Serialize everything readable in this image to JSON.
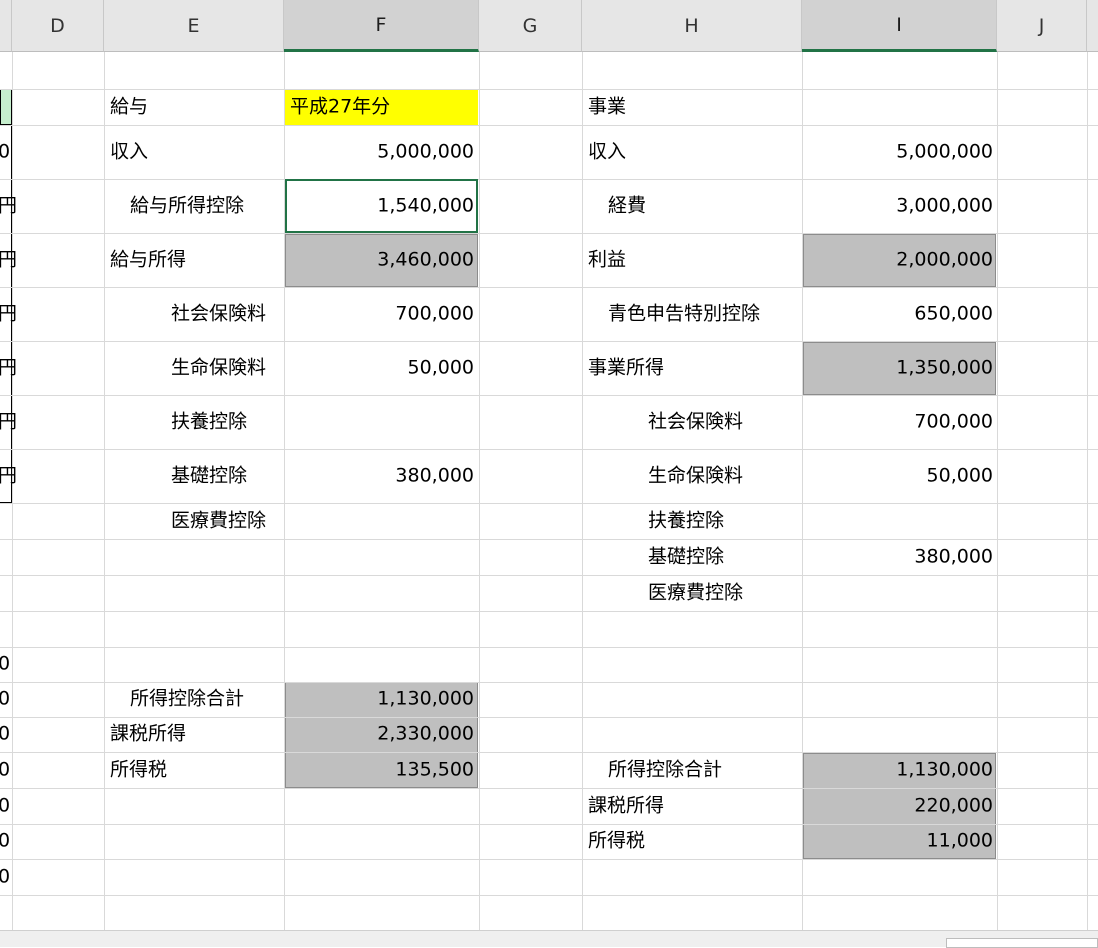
{
  "columns": [
    "D",
    "E",
    "F",
    "G",
    "H",
    "I",
    "J"
  ],
  "left_fragments": {
    "row3": "0",
    "row4": "円",
    "row5": "円",
    "row6": "円",
    "row7": "円",
    "row8": "円",
    "row9": "円",
    "row13": "0",
    "row14": "0",
    "row15": "0",
    "row16": "0",
    "row17": "0",
    "row18": "0",
    "row19": "0"
  },
  "salary": {
    "title": "給与",
    "year": "平成27年分",
    "income_label": "収入",
    "income": "5,000,000",
    "deduction_label": "給与所得控除",
    "deduction": "1,540,000",
    "salary_income_label": "給与所得",
    "salary_income": "3,460,000",
    "social_label": "社会保険料",
    "social": "700,000",
    "life_label": "生命保険料",
    "life": "50,000",
    "dependent_label": "扶養控除",
    "basic_label": "基礎控除",
    "basic": "380,000",
    "medical_label": "医療費控除",
    "total_deduction_label": "所得控除合計",
    "total_deduction": "1,130,000",
    "taxable_label": "課税所得",
    "taxable": "2,330,000",
    "tax_label": "所得税",
    "tax": "135,500"
  },
  "business": {
    "title": "事業",
    "income_label": "収入",
    "income": "5,000,000",
    "expense_label": "経費",
    "expense": "3,000,000",
    "profit_label": "利益",
    "profit": "2,000,000",
    "blue_label": "青色申告特別控除",
    "blue": "650,000",
    "business_income_label": "事業所得",
    "business_income": "1,350,000",
    "social_label": "社会保険料",
    "social": "700,000",
    "life_label": "生命保険料",
    "life": "50,000",
    "dependent_label": "扶養控除",
    "basic_label": "基礎控除",
    "basic": "380,000",
    "medical_label": "医療費控除",
    "total_deduction_label": "所得控除合計",
    "total_deduction": "1,130,000",
    "taxable_label": "課税所得",
    "taxable": "220,000",
    "tax_label": "所得税",
    "tax": "11,000"
  },
  "colors": {
    "header_bg": "#e6e6e6",
    "computed_fill": "#bfbfbf",
    "highlight": "#ffff00",
    "selection": "#217346"
  }
}
